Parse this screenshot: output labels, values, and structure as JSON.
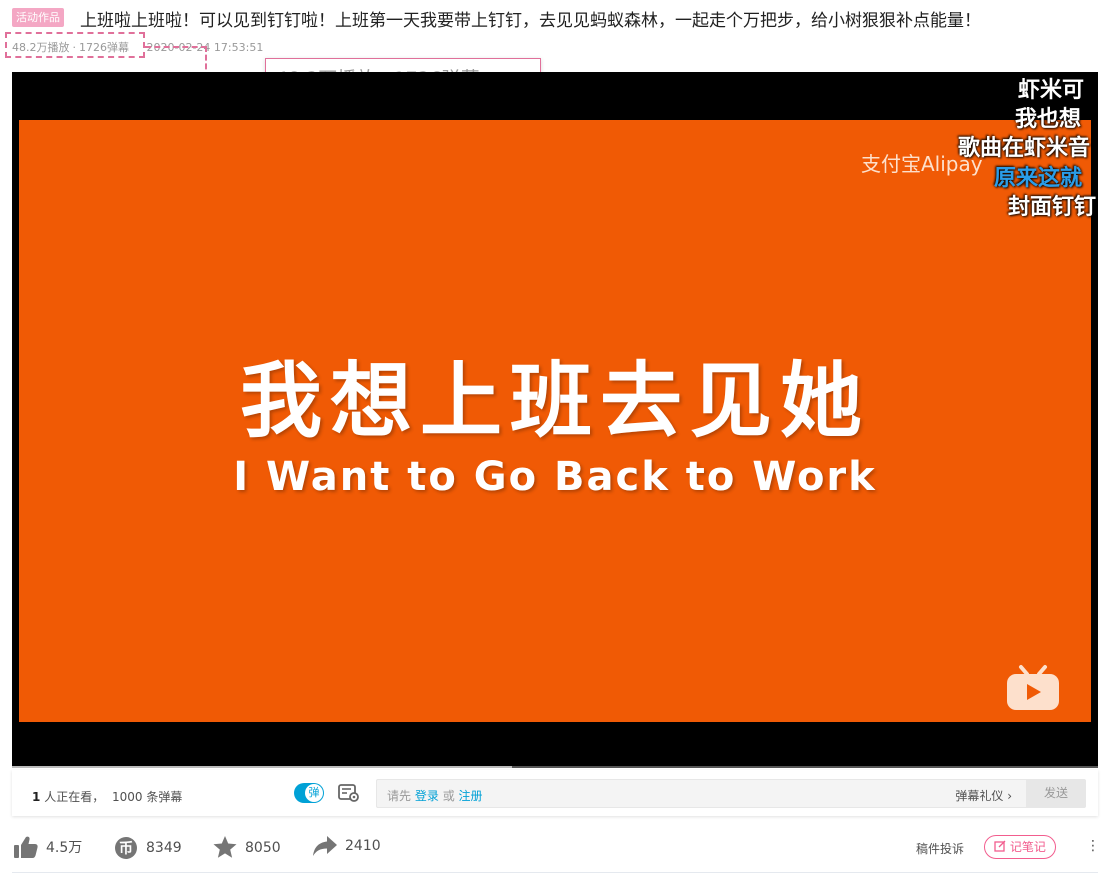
{
  "header": {
    "badge": "活动作品",
    "title": "上班啦上班啦！可以见到钉钉啦！上班第一天我要带上钉钉，去见见蚂蚁森林，一起走个万把步，给小树狠狠补点能量！"
  },
  "stats": {
    "plays": "48.2万播放",
    "separator": "·",
    "danmaku": "1726弹幕",
    "date": "2020-02-24 17:53:51",
    "zoom_text": "48.2万播放 · 1726弹幕"
  },
  "player": {
    "watermark": "支付宝Alipay",
    "main_text": "我想上班去见她",
    "sub_text": "I Want to Go Back to Work",
    "danmaku": [
      {
        "text": "虾米可",
        "blue": false
      },
      {
        "text": "我也想",
        "blue": false
      },
      {
        "text": "歌曲在虾米音",
        "blue": false
      },
      {
        "text": "原来这就",
        "blue": true
      },
      {
        "text": "封面钉钉",
        "blue": false
      }
    ],
    "progress": 0.46
  },
  "sendbar": {
    "watching_count": "1",
    "watching_text": "人正在看，",
    "danmaku_count": "1000",
    "danmaku_text": "条弹幕",
    "toggle_label": "弹",
    "input_hint_prefix": "请先",
    "login": "登录",
    "or": "或",
    "register": "注册",
    "etiquette": "弹幕礼仪 ›",
    "send": "发送"
  },
  "toolbar": {
    "like": "4.5万",
    "coin": "8349",
    "favorite": "8050",
    "share": "2410",
    "report": "稿件投诉",
    "note": "记笔记",
    "more": "⋮"
  },
  "colors": {
    "accent": "#00a1d6",
    "pink": "#f25d8e",
    "video_bg": "#f05a05"
  }
}
